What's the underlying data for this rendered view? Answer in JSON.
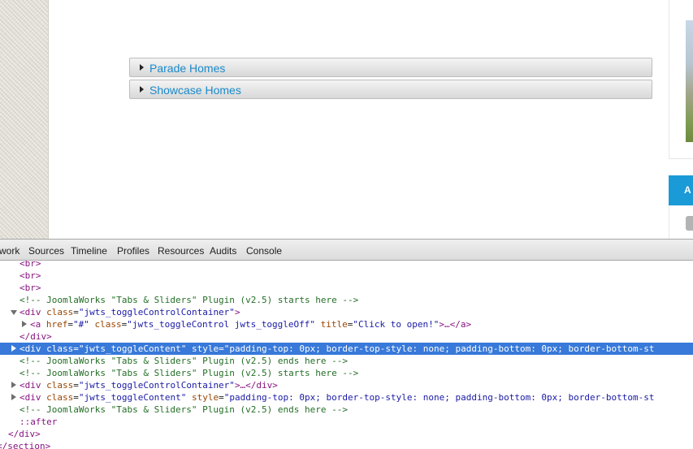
{
  "page": {
    "accordion": [
      {
        "label": "Parade Homes"
      },
      {
        "label": "Showcase Homes"
      }
    ],
    "right_banner_text": "A"
  },
  "devtools": {
    "tabs": [
      "work",
      "Sources",
      "Timeline",
      "Profiles",
      "Resources",
      "Audits",
      "Console"
    ],
    "dom_lines": [
      {
        "kind": "tag",
        "text": "<br>"
      },
      {
        "kind": "tag",
        "text": "<br>"
      },
      {
        "kind": "tag",
        "text": "<br>"
      },
      {
        "kind": "comment",
        "text": "<!-- JoomlaWorks \"Tabs & Sliders\" Plugin (v2.5) starts here -->"
      },
      {
        "kind": "open",
        "tag": "div",
        "attrs": [
          {
            "name": "class",
            "value": "\"jwts_toggleControlContainer\""
          }
        ],
        "suffix": ">"
      },
      {
        "kind": "open",
        "tag": "a",
        "attrs": [
          {
            "name": "href",
            "value": "\"#\""
          },
          {
            "name": "class",
            "value": "\"jwts_toggleControl jwts_toggleOff\""
          },
          {
            "name": "title",
            "value": "\"Click to open!\""
          }
        ],
        "suffix": ">…</a>"
      },
      {
        "kind": "tag",
        "text": "</div>"
      },
      {
        "kind": "open",
        "tag": "div",
        "attrs": [
          {
            "name": "class",
            "value": "\"jwts_toggleContent\""
          },
          {
            "name": "style",
            "value": "\"padding-top: 0px; border-top-style: none; padding-bottom: 0px; border-bottom-st"
          }
        ],
        "suffix": ""
      },
      {
        "kind": "comment",
        "text": "<!-- JoomlaWorks \"Tabs & Sliders\" Plugin (v2.5) ends here -->"
      },
      {
        "kind": "comment",
        "text": "<!-- JoomlaWorks \"Tabs & Sliders\" Plugin (v2.5) starts here -->"
      },
      {
        "kind": "open",
        "tag": "div",
        "attrs": [
          {
            "name": "class",
            "value": "\"jwts_toggleControlContainer\""
          }
        ],
        "suffix": ">…</div>"
      },
      {
        "kind": "open",
        "tag": "div",
        "attrs": [
          {
            "name": "class",
            "value": "\"jwts_toggleContent\""
          },
          {
            "name": "style",
            "value": "\"padding-top: 0px; border-top-style: none; padding-bottom: 0px; border-bottom-st"
          }
        ],
        "suffix": ""
      },
      {
        "kind": "comment",
        "text": "<!-- JoomlaWorks \"Tabs & Sliders\" Plugin (v2.5) ends here -->"
      },
      {
        "kind": "pseudo",
        "text": "::after"
      },
      {
        "kind": "tag",
        "text": "</div>"
      },
      {
        "kind": "tag",
        "text": "</section>"
      }
    ]
  }
}
